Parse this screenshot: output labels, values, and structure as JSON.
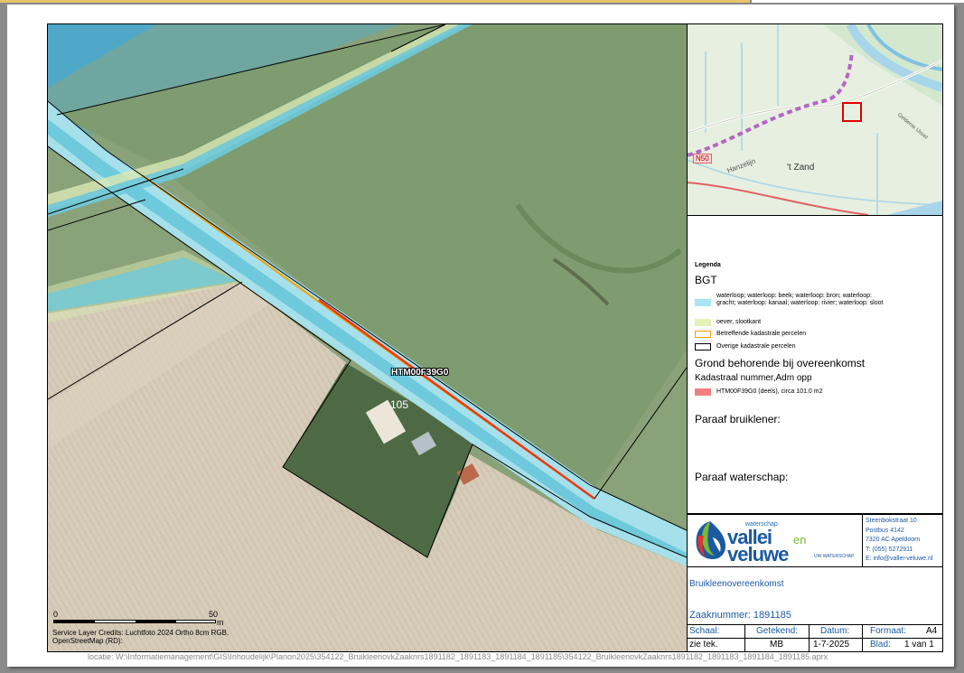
{
  "map": {
    "parcel_label": "HTM00F39G0",
    "house_number": "105",
    "scale": {
      "start": "0",
      "end": "50",
      "unit": "m"
    },
    "credits": [
      "Service Layer Credits: Luchtfoto 2024 Ortho 8cm RGB.",
      "OpenStreetMap (RD):"
    ]
  },
  "overview": {
    "road": "N50",
    "railway": "Hanzelijn",
    "place": "'t Zand",
    "river": "Gelderse IJssel"
  },
  "legend": {
    "title": "Legenda",
    "bgt_title": "BGT",
    "items": [
      {
        "label": "waterloop; waterloop: beek; waterloop: bron; waterloop: gracht; waterloop: kanaal; waterloop: rivier; waterloop: sloot",
        "fill": "#a8e6f5",
        "border": "#a8e6f5"
      },
      {
        "label": "oever, slootkant",
        "fill": "#e4f2b8",
        "border": "#e4f2b8"
      },
      {
        "label": "Betreffende kadastrale percelen",
        "fill": "#ffffff",
        "border": "#f5a000"
      },
      {
        "label": "Overige kadastrale percelen",
        "fill": "#ffffff",
        "border": "#000000"
      }
    ],
    "grond_title": "Grond behorende bij overeenkomst",
    "kad_title": "Kadastraal nummer,Adm opp",
    "kad_item": {
      "label": "HTM00F39G0 (deels), circa 101.0 m2",
      "fill": "#f08080"
    },
    "paraaf_bruiklener": "Paraaf bruiklener:",
    "paraaf_waterschap": "Paraaf waterschap:"
  },
  "logo": {
    "waterschap": "waterschap",
    "vallei": "vallei",
    "en": "en",
    "veluwe": "veluwe",
    "uw": "UW WATERSCHAP",
    "address": [
      "Steenbokstraat 10",
      "Postbus 4142",
      "7320 AC Apeldoorn",
      "T: (055) 5272911",
      "E: info@vallei-veluwe.nl"
    ]
  },
  "title_block": {
    "doc_title": "Bruikleenovereenkomst",
    "zaaknummer": "Zaaknummer: 1891185",
    "schaal_h": "Schaal:",
    "schaal_v": "zie tek.",
    "getekend_h": "Getekend:",
    "getekend_v": "MB",
    "datum_h": "Datum:",
    "datum_v": "1-7-2025",
    "formaat_h": "Formaat:",
    "formaat_v": "A4",
    "blad_h": "Blad:",
    "blad_v": "1 van 1"
  },
  "locatie": "locatie: W:\\Informatiemanagement\\GIS\\Inhoudelijk\\Planon2025\\354122_BruikleenovkZaaknrs1891182_1891183_1891184_1891185\\354122_BruikleenovkZaaknrs1891182_1891183_1891184_1891185.aprx"
}
